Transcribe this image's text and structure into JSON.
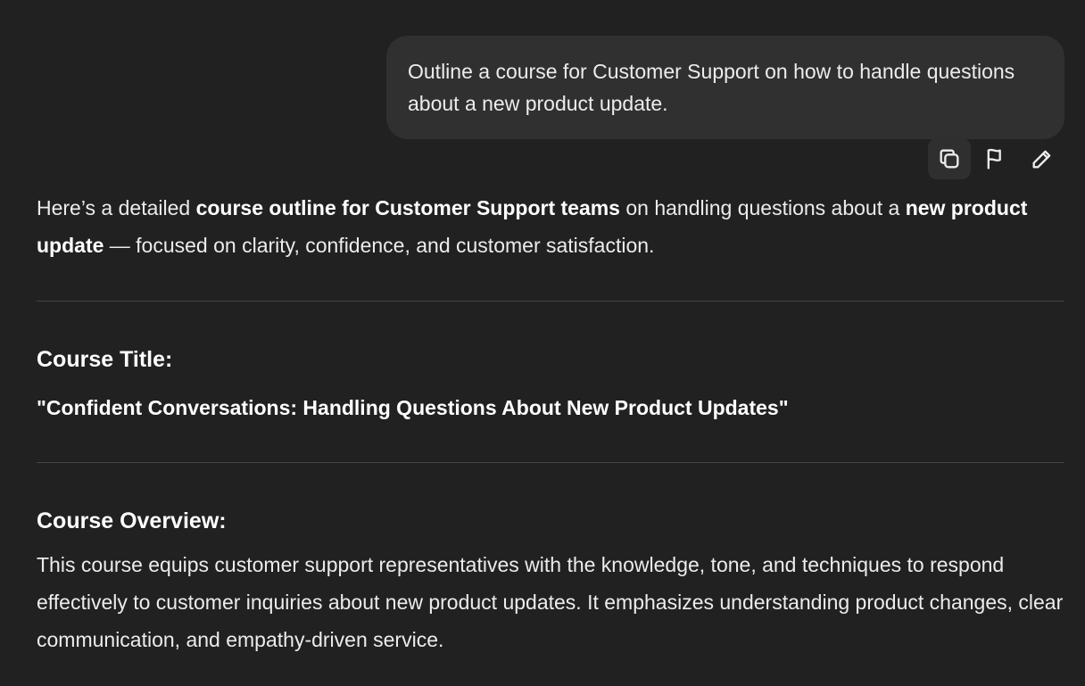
{
  "user_message": "Outline a course for Customer Support on how to handle questions about a new product update.",
  "actions": [
    {
      "name": "copy-icon"
    },
    {
      "name": "flag-icon"
    },
    {
      "name": "edit-icon"
    }
  ],
  "response": {
    "intro": {
      "part1": "Here’s a detailed ",
      "bold1": "course outline for Customer Support teams",
      "part2": " on handling questions about a ",
      "bold2": "new product update",
      "part3": " — focused on clarity, confidence, and customer satisfaction."
    },
    "course_title_heading": "Course Title:",
    "course_title": "\"Confident Conversations: Handling Questions About New Product Updates\"",
    "course_overview_heading": "Course Overview:",
    "course_overview": "This course equips customer support representatives with the knowledge, tone, and techniques to respond effectively to customer inquiries about new product updates. It emphasizes understanding product changes, clear communication, and empathy-driven service."
  }
}
